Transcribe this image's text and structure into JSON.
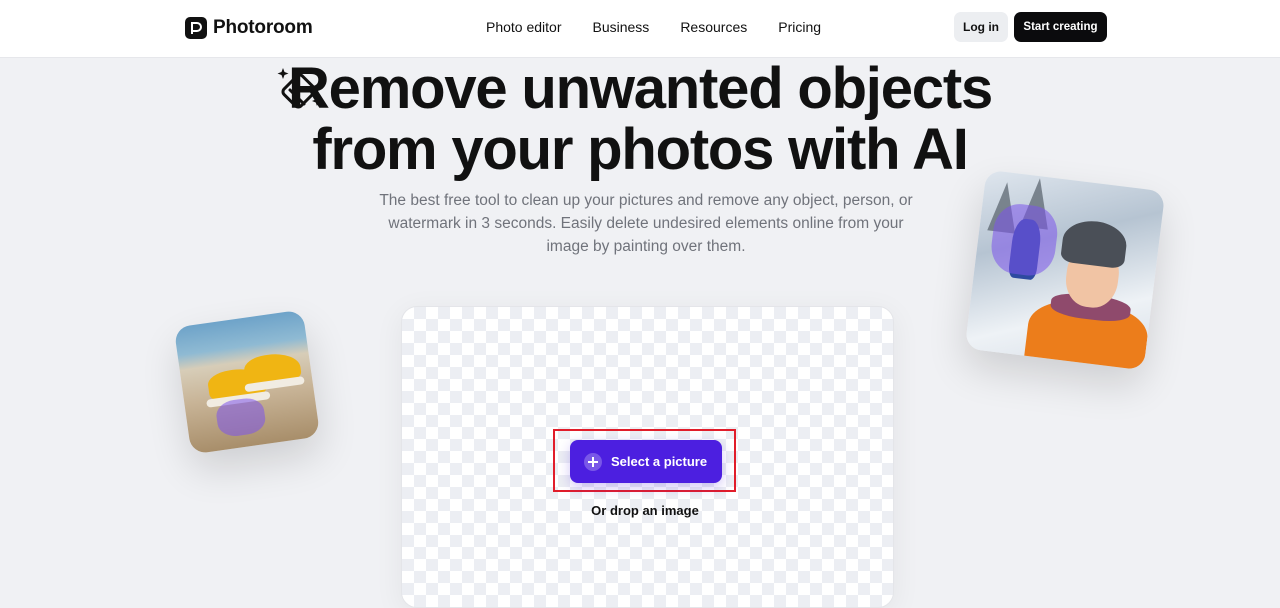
{
  "header": {
    "brand": "Photoroom",
    "nav": [
      "Photo editor",
      "Business",
      "Resources",
      "Pricing"
    ],
    "login_label": "Log in",
    "start_label": "Start creating"
  },
  "hero": {
    "title_line1": "Remove unwanted objects",
    "title_line2": "from your photos with AI",
    "subtitle": "The best free tool to clean up your pictures and remove any object, person, or watermark in 3 seconds. Easily delete undesired elements online from your image by painting over them."
  },
  "upload": {
    "select_label": "Select a picture",
    "drop_hint": "Or drop an image"
  },
  "colors": {
    "accent": "#4c1fe0",
    "highlight": "#e11d2a",
    "page_bg": "#f0f1f4"
  },
  "icons": {
    "brand": "photoroom-logo-icon",
    "hero": "eraser-sparkle-icon",
    "select": "plus-circle-icon"
  }
}
